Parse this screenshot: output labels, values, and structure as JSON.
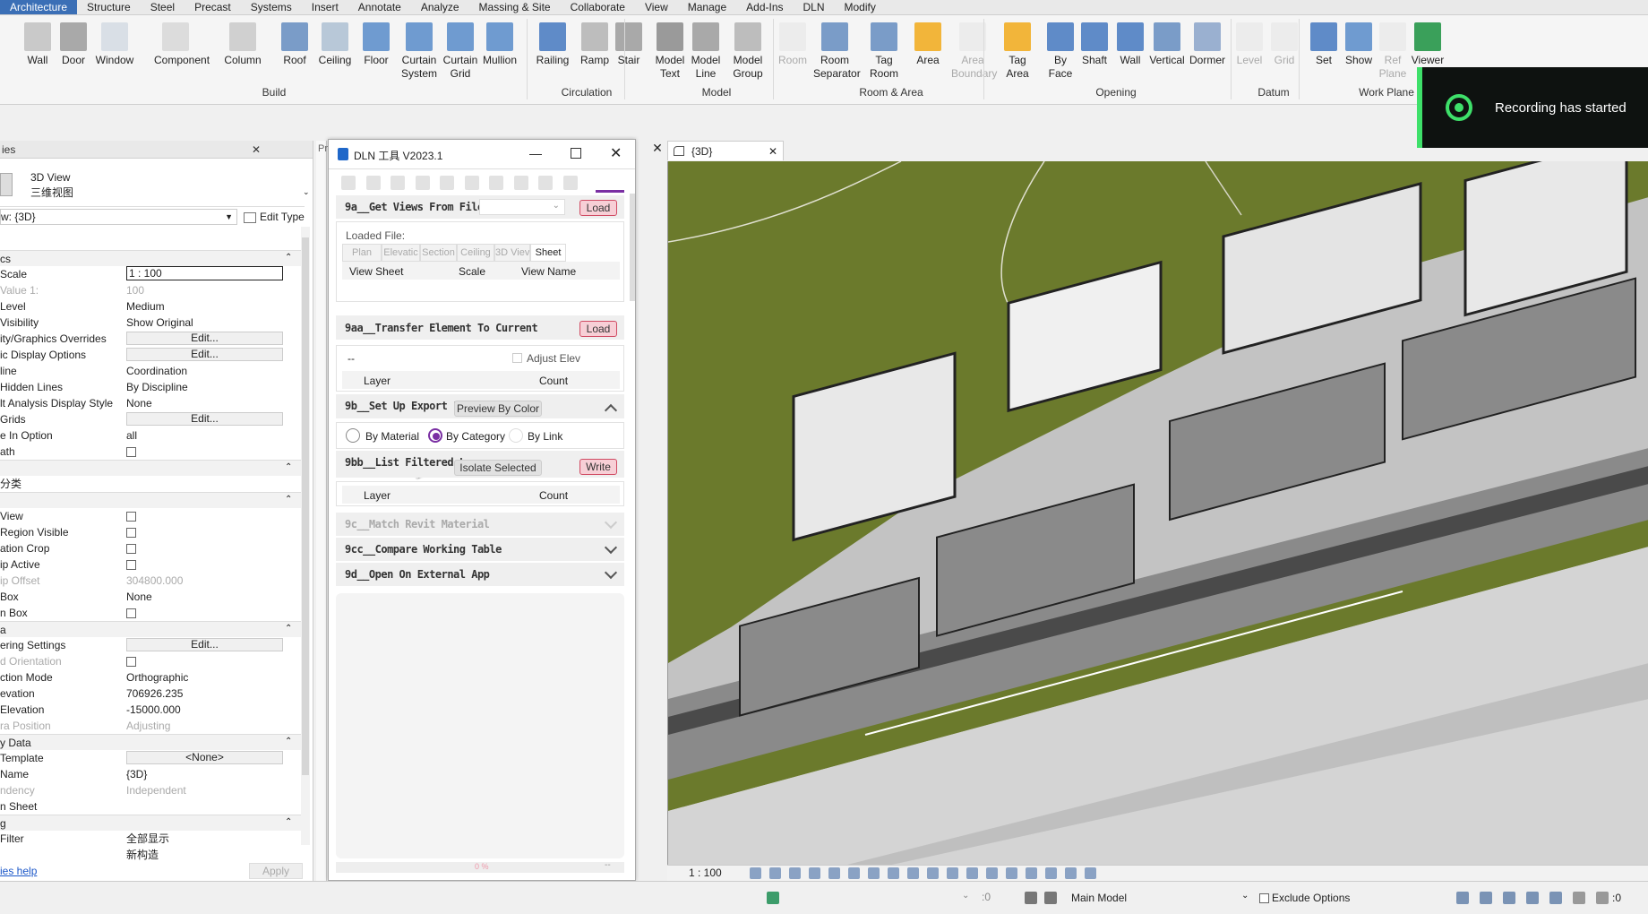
{
  "tabs": [
    "Architecture",
    "Structure",
    "Steel",
    "Precast",
    "Systems",
    "Insert",
    "Annotate",
    "Analyze",
    "Massing & Site",
    "Collaborate",
    "View",
    "Manage",
    "Add-Ins",
    "DLN",
    "Modify"
  ],
  "ribbon": {
    "buttons": [
      {
        "label": "Wall"
      },
      {
        "label": "Door"
      },
      {
        "label": "Window"
      },
      {
        "label": "Component"
      },
      {
        "label": "Column"
      },
      {
        "label": "Roof"
      },
      {
        "label": "Ceiling"
      },
      {
        "label": "Floor"
      },
      {
        "label": "Curtain\nSystem"
      },
      {
        "label": "Curtain\nGrid"
      },
      {
        "label": "Mullion"
      },
      {
        "label": "Railing"
      },
      {
        "label": "Ramp"
      },
      {
        "label": "Stair"
      },
      {
        "label": "Model\nText"
      },
      {
        "label": "Model\nLine"
      },
      {
        "label": "Model\nGroup"
      },
      {
        "label": "Room"
      },
      {
        "label": "Room\nSeparator"
      },
      {
        "label": "Tag\nRoom"
      },
      {
        "label": "Area"
      },
      {
        "label": "Area\nBoundary"
      },
      {
        "label": "Tag\nArea"
      },
      {
        "label": "By\nFace"
      },
      {
        "label": "Shaft"
      },
      {
        "label": "Wall"
      },
      {
        "label": "Vertical"
      },
      {
        "label": "Dormer"
      },
      {
        "label": "Level"
      },
      {
        "label": "Grid"
      },
      {
        "label": "Set"
      },
      {
        "label": "Show"
      },
      {
        "label": "Ref\nPlane"
      },
      {
        "label": "Viewer"
      }
    ],
    "groups": [
      "Build",
      "Circulation",
      "Model",
      "Room & Area",
      "Opening",
      "Datum",
      "Work Plane"
    ]
  },
  "recording": "Recording has started",
  "properties": {
    "header": "ies",
    "type_name": "3D View",
    "type_sub": "三维视图",
    "view_selector": "w: {3D}",
    "edit_type": "Edit Type",
    "rows": [
      {
        "k": "cs",
        "v": "",
        "section": true
      },
      {
        "k": "Scale",
        "v": "1 : 100",
        "style": "box"
      },
      {
        "k": "Value   1:",
        "v": "100",
        "dim": true
      },
      {
        "k": " Level",
        "v": "Medium"
      },
      {
        "k": "Visibility",
        "v": "Show Original"
      },
      {
        "k": "ity/Graphics Overrides",
        "v": "Edit...",
        "style": "btn"
      },
      {
        "k": "ic Display Options",
        "v": "Edit...",
        "style": "btn"
      },
      {
        "k": "line",
        "v": "Coordination"
      },
      {
        "k": " Hidden Lines",
        "v": "By Discipline"
      },
      {
        "k": "lt Analysis Display Style",
        "v": "None"
      },
      {
        "k": " Grids",
        "v": "Edit...",
        "style": "btn"
      },
      {
        "k": "e In Option",
        "v": "all"
      },
      {
        "k": "ath",
        "v": "",
        "check": true
      },
      {
        "k": "",
        "v": "",
        "section": true
      },
      {
        "k": "分类",
        "v": ""
      },
      {
        "k": "",
        "v": "",
        "section": true
      },
      {
        "k": "View",
        "v": "",
        "check": true
      },
      {
        "k": "Region Visible",
        "v": "",
        "check": true
      },
      {
        "k": "ation Crop",
        "v": "",
        "check": true
      },
      {
        "k": "ip Active",
        "v": "",
        "check": true
      },
      {
        "k": "ip Offset",
        "v": "304800.000",
        "dim": true
      },
      {
        "k": " Box",
        "v": "None"
      },
      {
        "k": "n Box",
        "v": "",
        "check": true
      },
      {
        "k": "a",
        "v": "",
        "section": true
      },
      {
        "k": "ering Settings",
        "v": "Edit...",
        "style": "btn"
      },
      {
        "k": "d Orientation",
        "v": "",
        "check": true,
        "dim": true
      },
      {
        "k": "ction Mode",
        "v": "Orthographic"
      },
      {
        "k": "evation",
        "v": "706926.235"
      },
      {
        "k": " Elevation",
        "v": "-15000.000"
      },
      {
        "k": "ra Position",
        "v": "Adjusting",
        "dim": true
      },
      {
        "k": "y Data",
        "v": "",
        "section": true
      },
      {
        "k": "Template",
        "v": "<None>",
        "style": "btn"
      },
      {
        "k": "Name",
        "v": "{3D}"
      },
      {
        "k": "ndency",
        "v": "Independent",
        "dim": true
      },
      {
        "k": "n Sheet",
        "v": ""
      },
      {
        "k": "g",
        "v": "",
        "section": true
      },
      {
        "k": " Filter",
        "v": "全部显示"
      },
      {
        "k": "",
        "v": "新构造"
      }
    ],
    "help": "ies help",
    "apply": "Apply"
  },
  "dln": {
    "title": "DLN 工具 V2023.1",
    "s9a": {
      "label": "9a__Get Views From File",
      "btn": "Load",
      "loaded": "Loaded File:",
      "tabs": [
        "Plan",
        "Elevatic",
        "Section",
        "Ceiling",
        "3D Viev",
        "Sheet"
      ],
      "cols": [
        "View Sheet",
        "Scale",
        "View Name"
      ]
    },
    "s9aa": {
      "label": "9aa__Transfer Element To Current",
      "btn": "Load",
      "dash": "--",
      "adjust": "Adjust Elev",
      "cols": [
        "Layer",
        "Count"
      ]
    },
    "s9b": {
      "label": "9b__Set Up Export Layers",
      "btn": "Preview By Color",
      "radios": [
        "By Material",
        "By Category",
        "By Link"
      ]
    },
    "s9bb": {
      "label": "9bb__List Filtered Layers",
      "btn": "Isolate Selected",
      "write": "Write",
      "cols": [
        "Layer",
        "Count"
      ]
    },
    "s9c": {
      "label": "9c__Match Revit Material"
    },
    "s9cc": {
      "label": "9cc__Compare Working Table"
    },
    "s9d": {
      "label": "9d__Open On External App"
    },
    "progress": "0 %",
    "dash": "--"
  },
  "viewport": {
    "tab": "{3D}",
    "scale": "1 : 100"
  },
  "status": {
    "model": "Main Model",
    "exclude": "Exclude Options",
    "zero1": ":0",
    "zero2": ":0"
  },
  "colors": {
    "accent": "#3b6fb6",
    "green": "#6b7a2c",
    "record": "#3ee06a",
    "dln_accent": "#7a2fa3",
    "load": "#d04b63"
  }
}
